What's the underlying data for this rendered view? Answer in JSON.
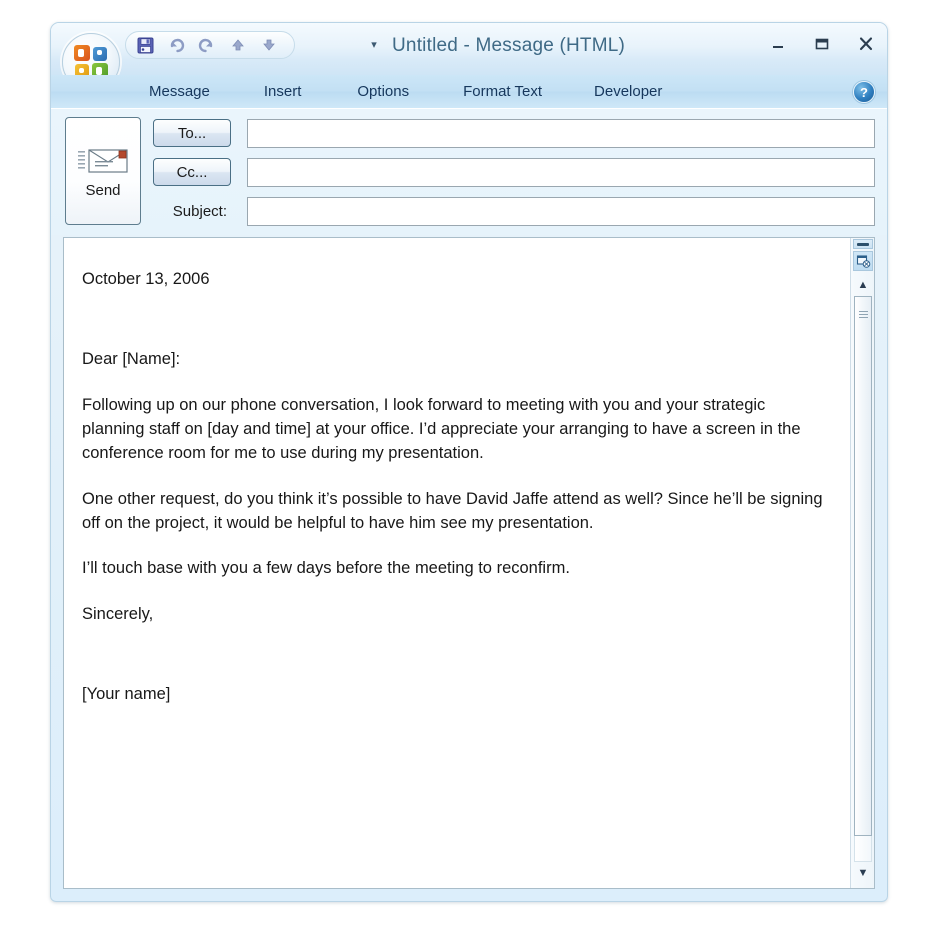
{
  "window": {
    "title": "Untitled - Message (HTML)",
    "orb_icon": "office-orb-icon",
    "controls": {
      "minimize": "–",
      "maximize": "▭",
      "close": "✕"
    }
  },
  "quick_access": {
    "dropdown": "▾",
    "items": [
      {
        "name": "save",
        "glyph": "💾"
      },
      {
        "name": "undo",
        "glyph": "↶"
      },
      {
        "name": "redo",
        "glyph": "↷"
      },
      {
        "name": "previous-item",
        "glyph": "▲"
      },
      {
        "name": "next-item",
        "glyph": "▼"
      }
    ]
  },
  "ribbon": {
    "tabs": [
      {
        "label": "Message"
      },
      {
        "label": "Insert"
      },
      {
        "label": "Options"
      },
      {
        "label": "Format Text"
      },
      {
        "label": "Developer"
      }
    ],
    "help_label": "?"
  },
  "compose": {
    "send_label": "Send",
    "to_label": "To...",
    "cc_label": "Cc...",
    "subject_label": "Subject:",
    "to_value": "",
    "cc_value": "",
    "subject_value": "",
    "to_placeholder": "",
    "cc_placeholder": "",
    "subject_placeholder": ""
  },
  "body": {
    "date": "October 13, 2006",
    "salutation": "Dear [Name]:",
    "paragraph1": "Following up on our phone conversation, I look forward to meeting with you and your strategic planning staff on [day and time] at your office. I’d appreciate your arranging to have a screen in the conference room for me to use during my presentation.",
    "paragraph2": "One other request, do you think it’s possible to have David Jaffe attend as well? Since he’ll be signing off on the project, it would be helpful to have him see my presentation.",
    "paragraph3": "I’ll touch base with you a few days before the meeting to reconfirm.",
    "closing": "Sincerely,",
    "signature": "[Your name]"
  },
  "scrollbar": {
    "up_arrow": "▲",
    "down_arrow": "▼"
  },
  "colors": {
    "frame": "#b9d4e6",
    "ribbon": "#c3e0f4",
    "title_text": "#3f6a86",
    "tab_text": "#16375c",
    "body_text": "#181818"
  }
}
